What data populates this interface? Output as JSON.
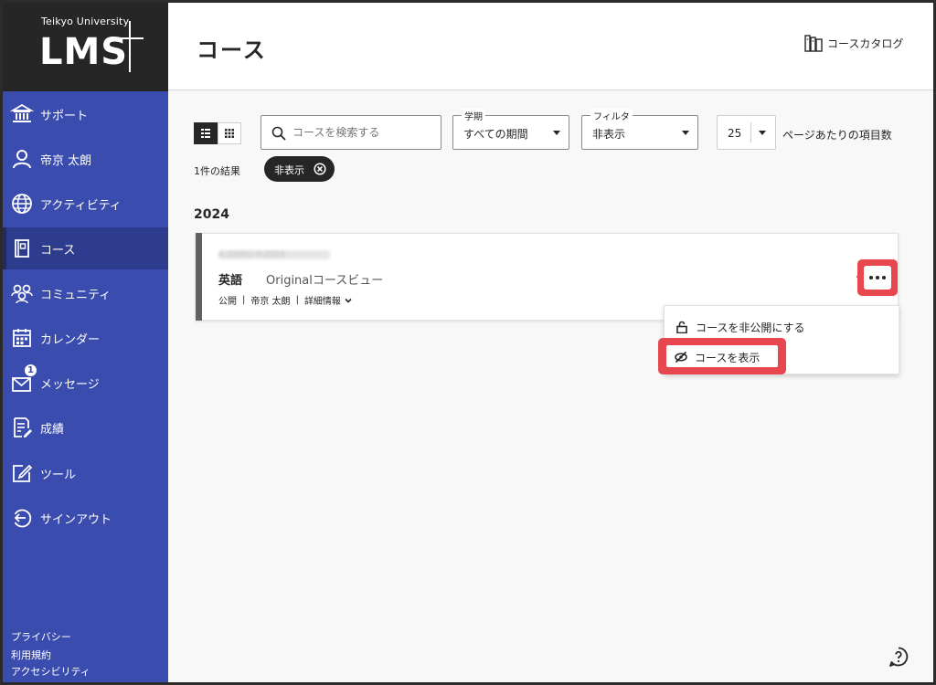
{
  "brand": {
    "university": "Teikyo University",
    "product": "LMS"
  },
  "sidebar": {
    "items": [
      {
        "label": "サポート",
        "icon": "bank-icon"
      },
      {
        "label": "帝京 太朗",
        "icon": "person-icon"
      },
      {
        "label": "アクティビティ",
        "icon": "globe-icon"
      },
      {
        "label": "コース",
        "icon": "course-book-icon",
        "active": true
      },
      {
        "label": "コミュニティ",
        "icon": "community-icon"
      },
      {
        "label": "カレンダー",
        "icon": "calendar-icon"
      },
      {
        "label": "メッセージ",
        "icon": "envelope-icon",
        "badge": "1"
      },
      {
        "label": "成績",
        "icon": "grades-icon"
      },
      {
        "label": "ツール",
        "icon": "edit-tool-icon"
      },
      {
        "label": "サインアウト",
        "icon": "sign-out-icon"
      }
    ],
    "footer": [
      "プライバシー",
      "利用規約",
      "アクセシビリティ"
    ]
  },
  "header": {
    "title": "コース",
    "catalog_label": "コースカタログ"
  },
  "toolbar": {
    "search_placeholder": "コースを検索する",
    "term": {
      "legend": "学期",
      "value": "すべての期間"
    },
    "filter": {
      "legend": "フィルタ",
      "value": "非表示"
    },
    "per_page": {
      "value": "25",
      "label": "ページあたりの項目数"
    }
  },
  "results": {
    "count_text": "1件の結果",
    "active_filter_chip": "非表示"
  },
  "year_heading": "2024",
  "course": {
    "id_blurred": "A-10001-0-2024",
    "title": "英語",
    "view": "Originalコースビュー",
    "status": "公開",
    "instructor": "帝京 太朗",
    "details_label": "詳細情報"
  },
  "context_menu": {
    "items": [
      {
        "label": "コースを非公開にする",
        "icon": "unlock-icon"
      },
      {
        "label": "コースを表示",
        "icon": "eye-slash-icon",
        "highlighted": true
      }
    ]
  },
  "colors": {
    "sidebar_bg": "#3a4cad",
    "sidebar_active": "#2d3c8c",
    "logo_bg": "#262626",
    "highlight_red": "#e74850"
  }
}
